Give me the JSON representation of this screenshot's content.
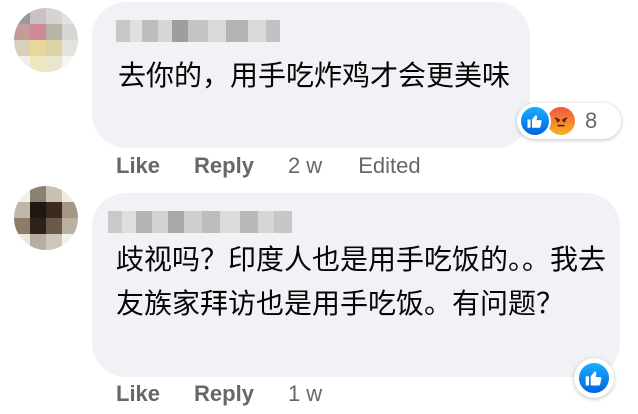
{
  "comments": [
    {
      "text": "去你的，用手吃炸鸡才会更美味",
      "actions": {
        "like": "Like",
        "reply": "Reply",
        "time": "2 w",
        "edited": "Edited"
      },
      "reactions": {
        "icons": [
          "like-icon",
          "angry-icon"
        ],
        "count": "8"
      }
    },
    {
      "text": "歧视吗？印度人也是用手吃饭的。。我去友族家拜访也是用手吃饭。有问题？",
      "actions": {
        "like": "Like",
        "reply": "Reply",
        "time": "1 w"
      },
      "reactions": {
        "icons": [
          "like-icon"
        ]
      }
    }
  ],
  "colors": {
    "bubble": "#f0f2f5",
    "meta_text": "#65676b",
    "like_blue": "#0866ff"
  }
}
